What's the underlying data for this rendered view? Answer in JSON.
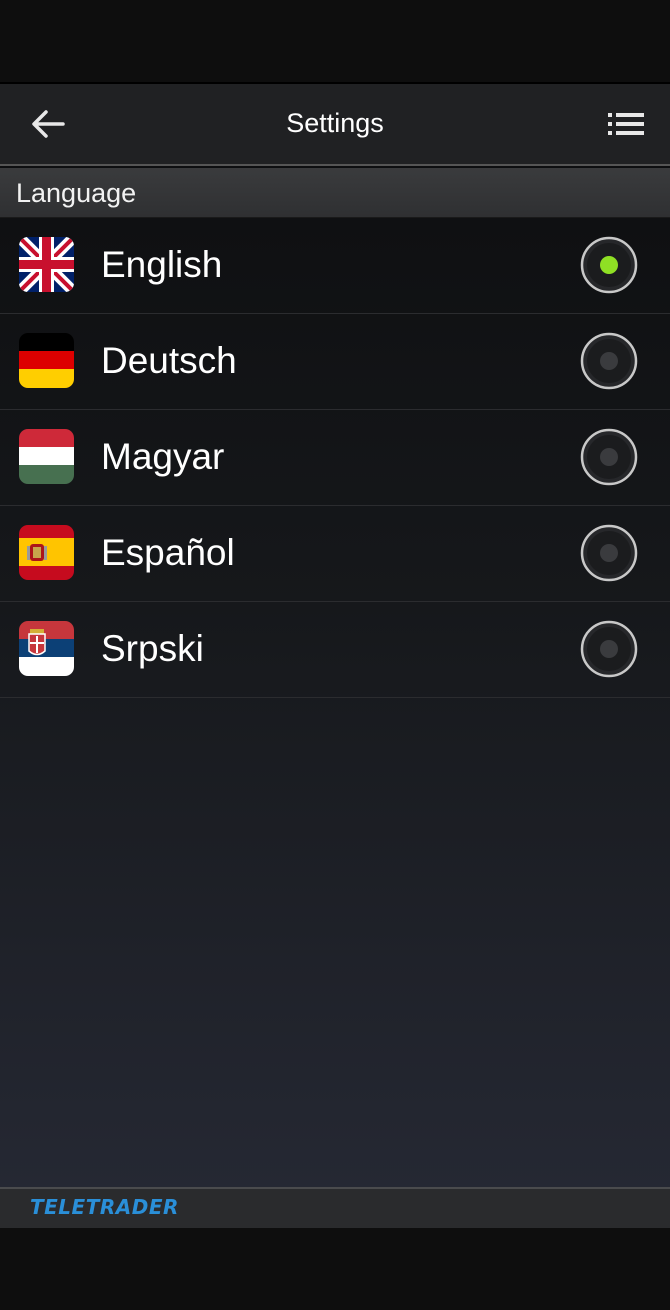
{
  "header": {
    "title": "Settings",
    "back_icon": "arrow-left-icon",
    "menu_icon": "list-icon"
  },
  "section": {
    "title": "Language"
  },
  "languages": [
    {
      "label": "English",
      "flag": "uk-flag-icon",
      "selected": true
    },
    {
      "label": "Deutsch",
      "flag": "germany-flag-icon",
      "selected": false
    },
    {
      "label": "Magyar",
      "flag": "hungary-flag-icon",
      "selected": false
    },
    {
      "label": "Español",
      "flag": "spain-flag-icon",
      "selected": false
    },
    {
      "label": "Srpski",
      "flag": "serbia-flag-icon",
      "selected": false
    }
  ],
  "footer": {
    "brand": "TELETRADER"
  },
  "colors": {
    "selected_dot": "#8fe024",
    "brand": "#2a8fd8",
    "toolbar_bg": "#202123"
  }
}
